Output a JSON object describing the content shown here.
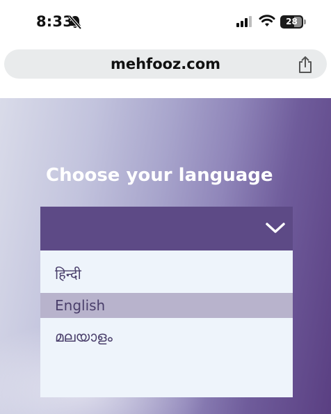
{
  "status_bar": {
    "time": "8:33",
    "battery_level": "28",
    "icons": [
      "bell-slash-icon",
      "signal-icon",
      "wifi-icon",
      "battery-icon"
    ]
  },
  "browser": {
    "url": "mehfooz.com",
    "share_icon": "share-icon"
  },
  "main": {
    "heading": "Choose your language",
    "dropdown": {
      "chevron_icon": "chevron-down-icon",
      "options": [
        {
          "label": "हिन्दी",
          "selected": false
        },
        {
          "label": "English",
          "selected": true
        },
        {
          "label": "മലയാളം",
          "selected": false
        }
      ]
    }
  },
  "colors": {
    "dropdown_header": "#5d4a86",
    "dropdown_list": "#eef4fb",
    "selected_option": "#b8b3cc",
    "option_text": "#4a3f6b"
  }
}
